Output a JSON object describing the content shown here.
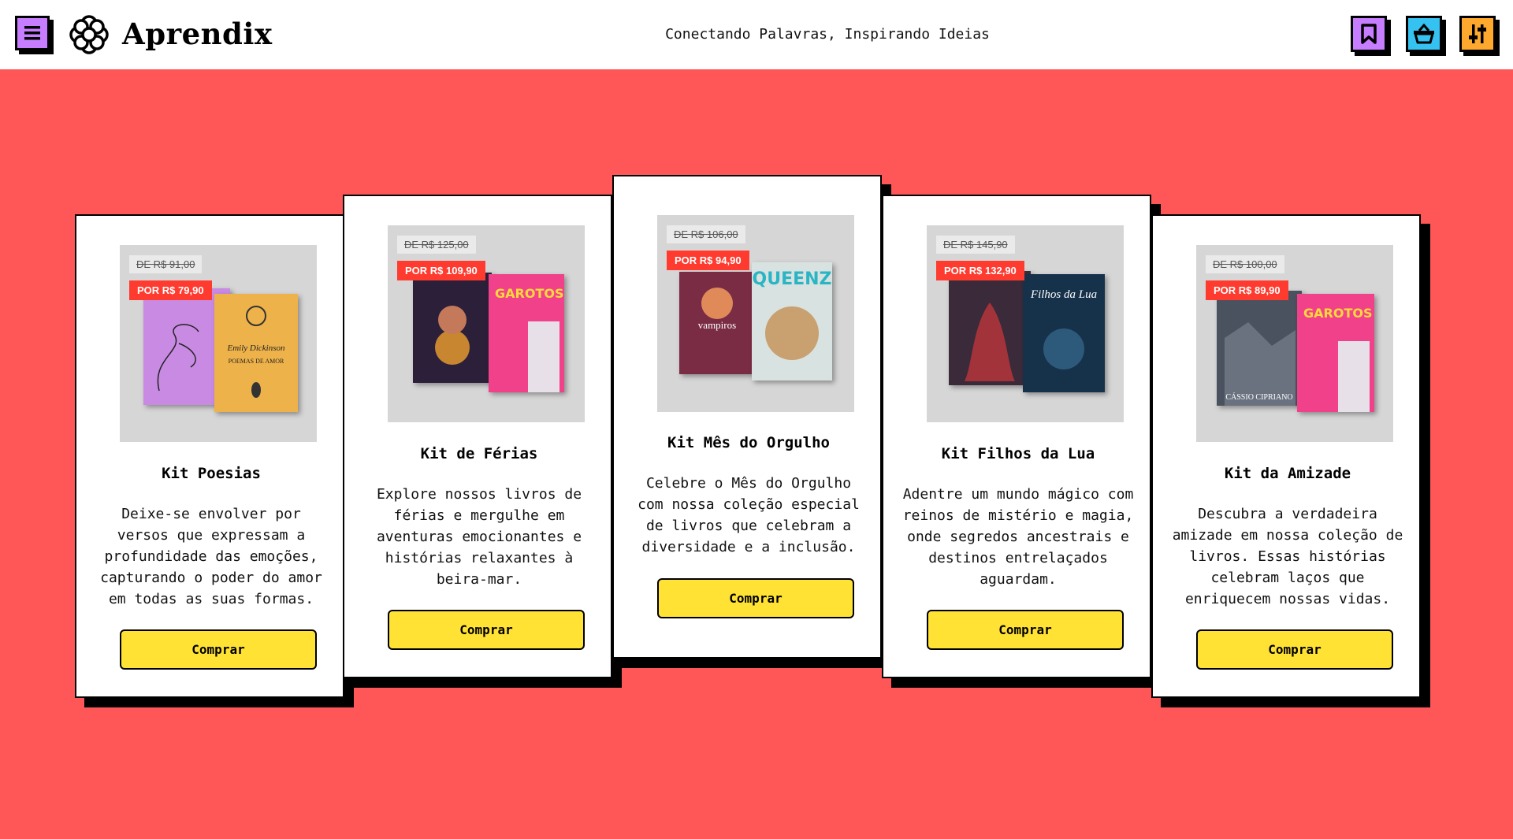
{
  "header": {
    "brand": "Aprendix",
    "tagline": "Conectando Palavras, Inspirando Ideias",
    "menu_icon": "menu-icon",
    "actions": [
      {
        "name": "bookmark-icon",
        "color": "#c77dff"
      },
      {
        "name": "basket-icon",
        "color": "#35c2f0"
      },
      {
        "name": "settings-icon",
        "color": "#ffa82e"
      }
    ]
  },
  "colors": {
    "background": "#ff5757",
    "button": "#ffe234",
    "price_tag": "#ff3b30"
  },
  "cards": [
    {
      "title": "Kit Poesias",
      "old_price": "DE R$ 91,00",
      "new_price": "POR R$ 79,90",
      "description": "Deixe-se envolver por versos que expressam a profundidade das emoções, capturando o poder do amor em todas as suas formas.",
      "button": "Comprar"
    },
    {
      "title": "Kit de Férias",
      "old_price": "DE R$ 125,00",
      "new_price": "POR R$ 109,90",
      "description": "Explore nossos livros de férias e mergulhe em aventuras emocionantes e histórias relaxantes à beira-mar.",
      "button": "Comprar"
    },
    {
      "title": "Kit Mês do Orgulho",
      "old_price": "DE R$ 106,00",
      "new_price": "POR R$ 94,90",
      "description": "Celebre o Mês do Orgulho com nossa coleção especial de livros que celebram a diversidade e a inclusão.",
      "button": "Comprar"
    },
    {
      "title": "Kit Filhos da Lua",
      "old_price": "DE R$ 145,90",
      "new_price": "POR R$ 132,90",
      "description": "Adentre um mundo mágico com reinos de mistério e magia, onde segredos ancestrais e destinos entrelaçados aguardam.",
      "button": "Comprar"
    },
    {
      "title": "Kit da Amizade",
      "old_price": "DE R$ 100,00",
      "new_price": "POR R$ 89,90",
      "description": "Descubra a verdadeira amizade em nossa coleção de livros. Essas histórias celebram laços que enriquecem nossas vidas.",
      "button": "Comprar"
    }
  ]
}
